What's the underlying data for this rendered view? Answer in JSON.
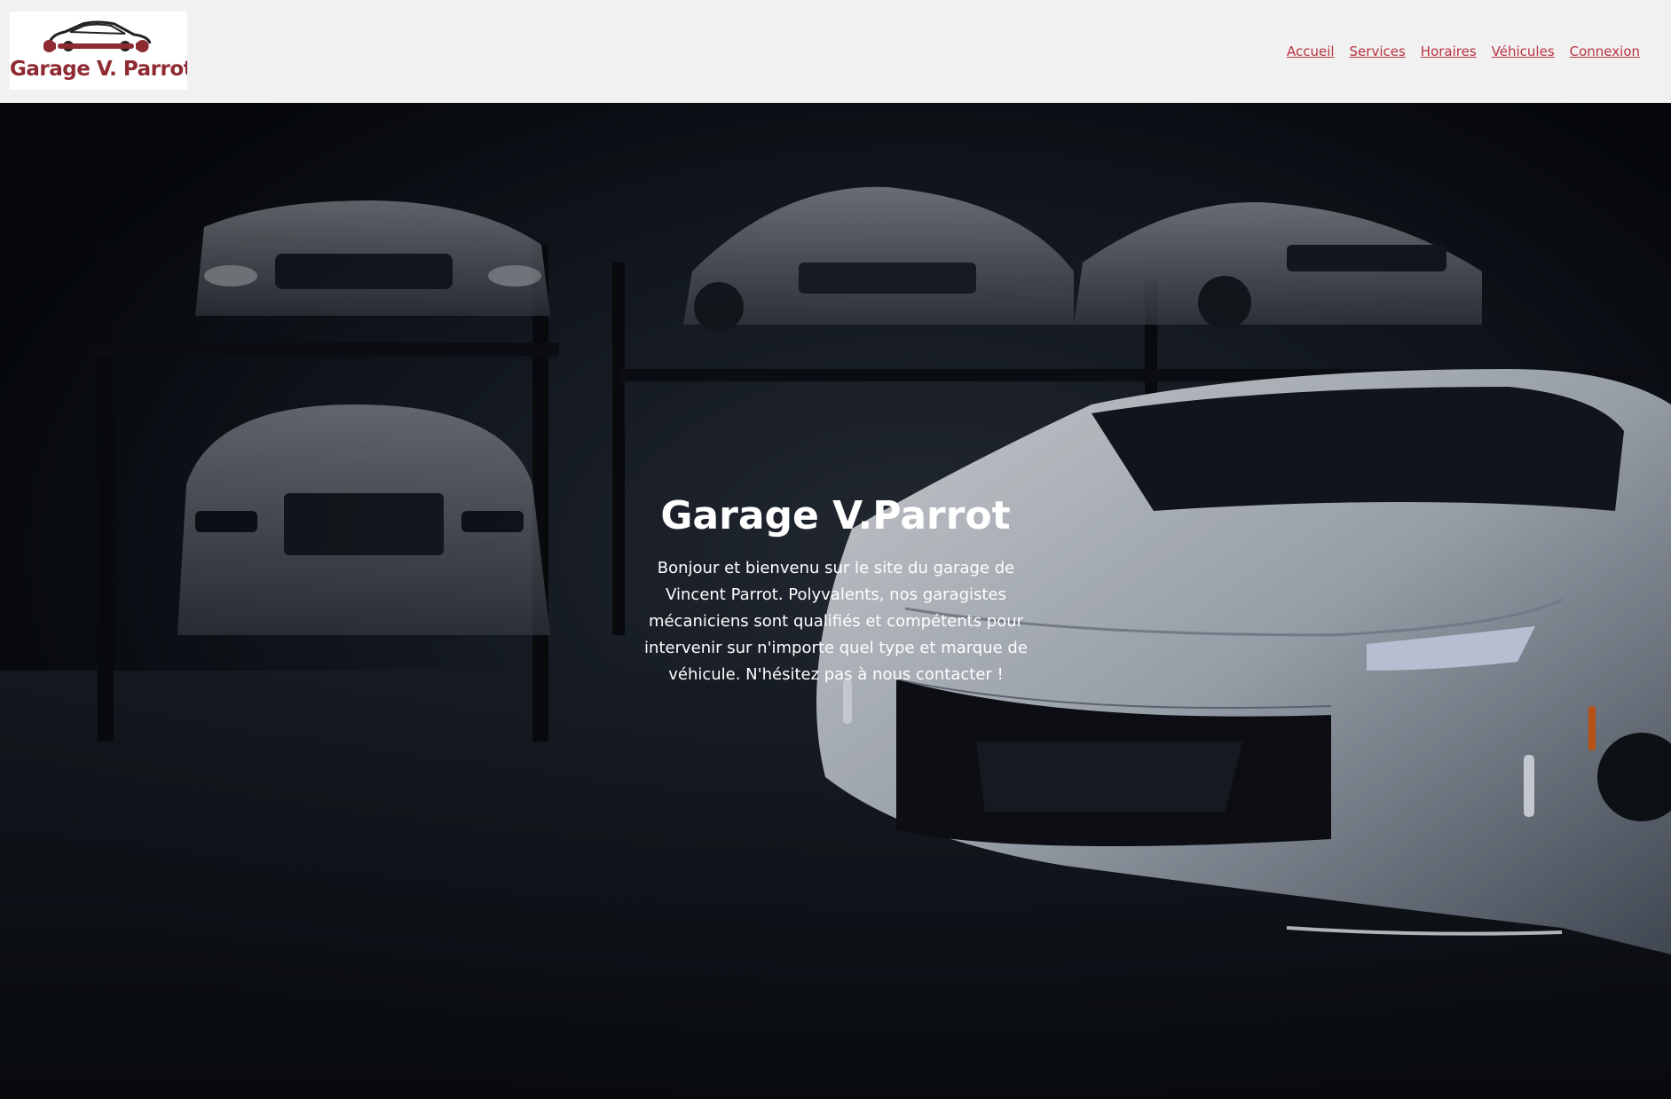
{
  "header": {
    "logo_text": "Garage V. Parrot",
    "logo_icon": "car-wrench-logo-icon",
    "nav": [
      {
        "label": "Accueil"
      },
      {
        "label": "Services"
      },
      {
        "label": "Horaires"
      },
      {
        "label": "Véhicules"
      },
      {
        "label": "Connexion"
      }
    ]
  },
  "hero": {
    "background_icon": "garage-cars-photo",
    "title": "Garage V.Parrot",
    "text": "Bonjour et bienvenu sur le site du garage de Vincent Parrot. Polyvalents, nos garagistes mécaniciens sont qualifiés et compétents pour intervenir sur n'importe quel type et marque de véhicule. N'hésitez pas à nous contacter !"
  },
  "colors": {
    "brand": "#8e2a32",
    "nav_link": "#b8323f",
    "header_bg": "#f1f1f1"
  }
}
